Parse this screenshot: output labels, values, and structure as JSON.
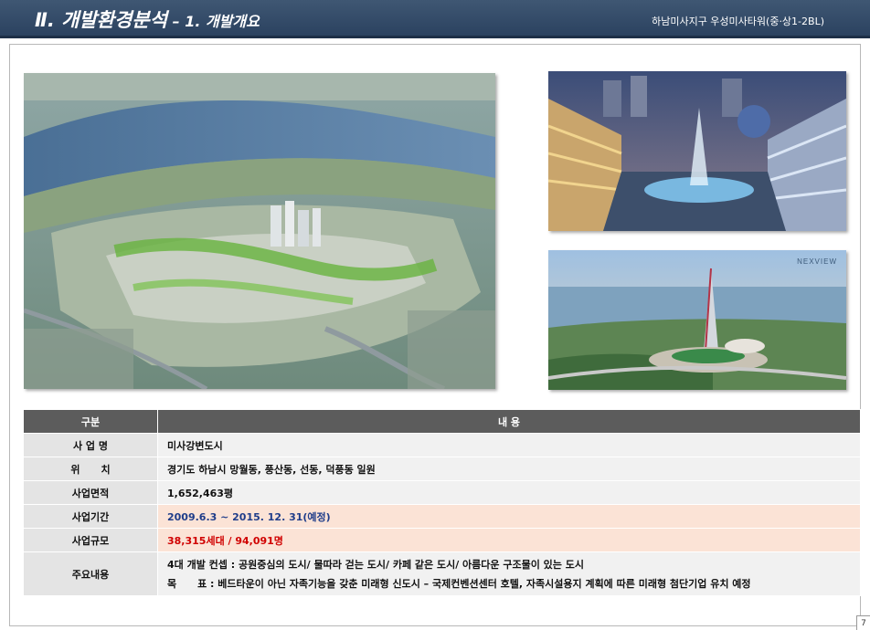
{
  "header": {
    "title": "Ⅱ. 개발환경분석",
    "subtitle": " – 1. 개발개요",
    "site_name": "하남미사지구 우성미사타워(중·상1-2BL)"
  },
  "images": {
    "main": "aerial-city-rendering",
    "side1": "shopping-mall-plaza-rendering",
    "side2": "riverside-tower-rendering",
    "side2_logo": "NEXVIEW"
  },
  "table": {
    "header": {
      "col1": "구분",
      "col2": "내 용"
    },
    "rows": [
      {
        "label": "사 업 명",
        "value": "미사강변도시"
      },
      {
        "label": "위      치",
        "value": "경기도 하남시 망월동, 풍산동, 선동, 덕풍동 일원"
      },
      {
        "label": "사업면적",
        "value": "1,652,463평"
      },
      {
        "label": "사업기간",
        "value": "2009.6.3 ~ 2015. 12. 31(예정)"
      },
      {
        "label": "사업규모",
        "value": "38,315세대 / 94,091명"
      }
    ],
    "content": {
      "label": "주요내용",
      "line1": "4대 개발 컨셉 : 공원중심의 도시/ 물따라 걷는 도시/ 카페 같은 도시/ 아름다운 구조물이 있는 도시",
      "line2": "목      표 : 베드타운이 아닌 자족기능을 갖춘 미래형 신도시 – 국제컨벤션센터 호텔, 자족시설용지 계획에 따른 미래형 첨단기업 유치 예정"
    }
  },
  "page_number": "7",
  "colors": {
    "header_bg": "#2f4766",
    "table_header": "#5c5c5c",
    "highlight_row": "#fbe3d6",
    "period_text": "#1f3d8a",
    "scale_text": "#d00000"
  }
}
